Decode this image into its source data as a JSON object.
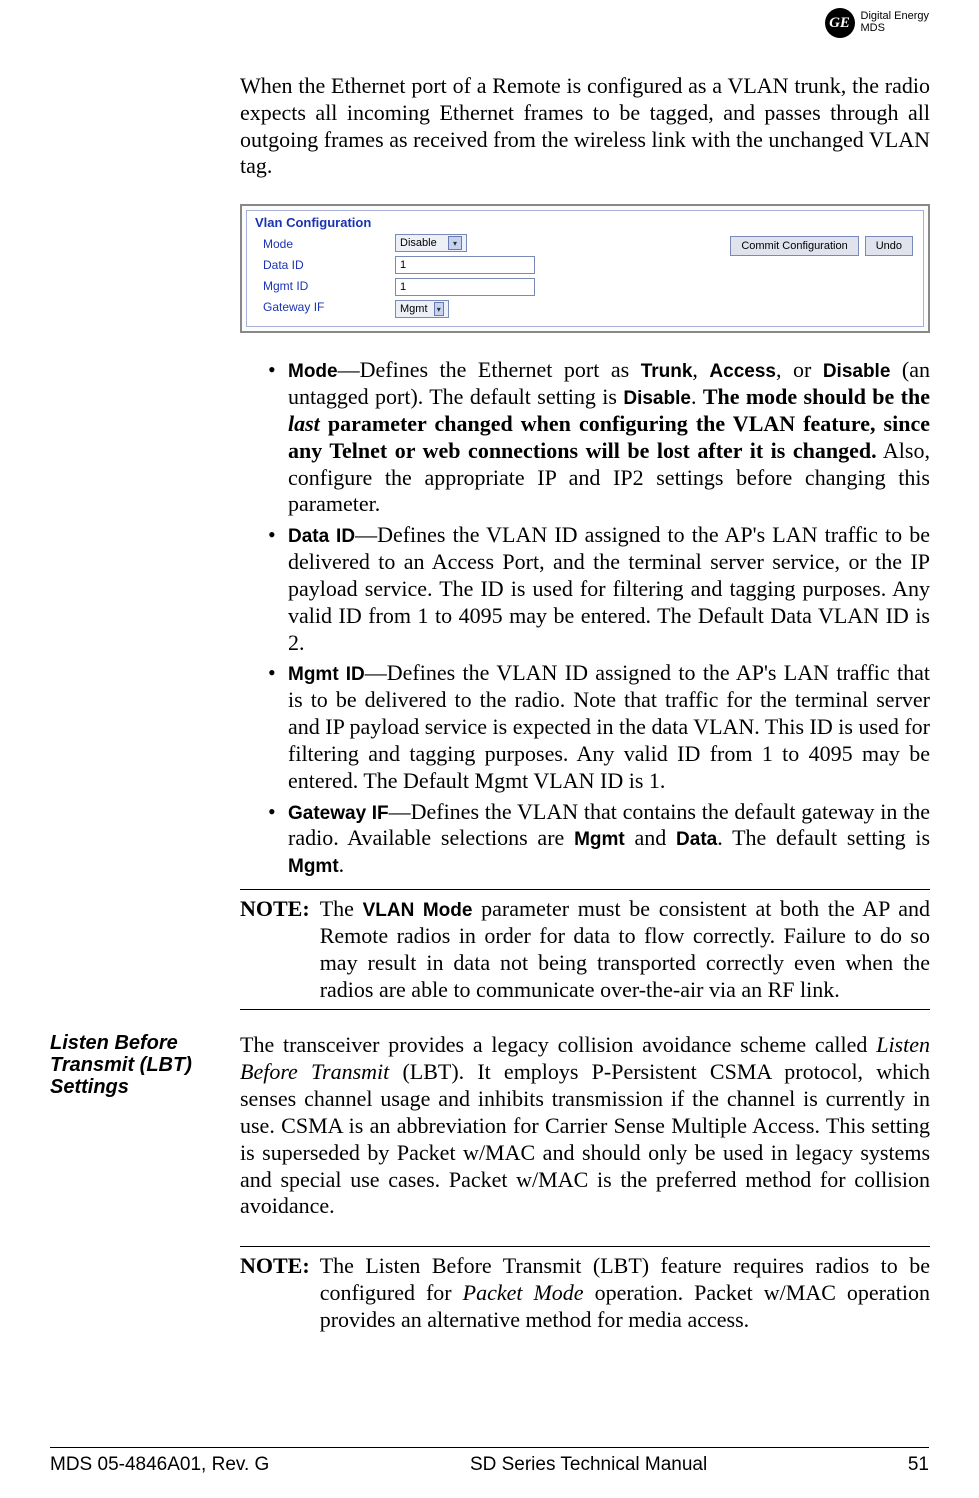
{
  "header": {
    "logo_monogram": "GE",
    "logo_line1": "Digital Energy",
    "logo_line2": "MDS"
  },
  "intro_paragraph": "When the Ethernet port of a Remote is configured as a VLAN trunk, the radio expects all incoming Ethernet frames to be tagged, and passes through all outgoing frames as received from the wireless link with the unchanged VLAN tag.",
  "panel": {
    "title": "Vlan Configuration",
    "labels": {
      "mode": "Mode",
      "data_id": "Data ID",
      "mgmt_id": "Mgmt ID",
      "gateway_if": "Gateway IF"
    },
    "values": {
      "mode": "Disable",
      "data_id": "1",
      "mgmt_id": "1",
      "gateway_if": "Mgmt"
    },
    "buttons": {
      "commit": "Commit Configuration",
      "undo": "Undo"
    }
  },
  "bullets": {
    "mode": {
      "label": "Mode",
      "t1": "—Defines the Ethernet port as ",
      "opt1": "Trunk",
      "comma": ", ",
      "opt2": "Access",
      "t2": ", or ",
      "opt3": "Disable",
      "t3": " (an untagged port). The default setting is ",
      "opt4": "Disable",
      "t4": ". ",
      "bold1": "The mode should be the ",
      "ital": "last",
      "bold2": " parameter changed when configuring the VLAN feature, since any Telnet or web connections will be lost after it is changed.",
      "t5": " Also, configure the appropriate IP and IP2 settings before changing this parameter."
    },
    "data_id": {
      "label": "Data ID",
      "text": "—Defines the VLAN ID assigned to the AP's LAN traffic to be delivered to an Access Port, and the terminal server service, or the IP payload service. The ID is used for filtering and tagging purposes. Any valid ID from 1 to 4095 may be entered. The Default Data VLAN ID is 2."
    },
    "mgmt_id": {
      "label": "Mgmt ID",
      "text": "—Defines the VLAN ID assigned to the AP's LAN traffic that is to be delivered to the radio. Note that traffic for the terminal server and IP payload service is expected in the data VLAN. This ID is used for filtering and tagging purposes. Any valid ID from 1 to 4095 may be entered. The Default Mgmt VLAN ID is 1."
    },
    "gateway_if": {
      "label": "Gateway IF",
      "t1": "—Defines the VLAN that contains the default gateway in the radio. Available selections are ",
      "opt1": "Mgmt",
      "t2": " and ",
      "opt2": "Data",
      "t3": ". The default setting is ",
      "opt3": "Mgmt",
      "t4": "."
    }
  },
  "note1": {
    "label": "NOTE:",
    "t1": "The ",
    "bold": "VLAN Mode",
    "t2": " parameter must be consistent at both the AP and Remote radios in order for data to flow correctly. Failure to do so may result in data not being transported correctly even when the radios are able to communicate over-the-air via an RF link."
  },
  "lbt": {
    "heading": "Listen Before Transmit (LBT) Settings",
    "p1a": "The transceiver provides a legacy collision avoidance scheme called ",
    "ital": "Listen Before Transmit",
    "p1b": " (LBT). It employs P-Persistent CSMA protocol, which senses channel usage and inhibits transmission if the channel is currently in use. CSMA is an abbreviation for Carrier Sense Multiple Access. This setting is superseded by Packet w/MAC and should only be used in legacy systems and special use cases. Packet w/MAC is the preferred method for collision avoidance."
  },
  "note2": {
    "label": "NOTE:",
    "t1": "The Listen Before Transmit (LBT) feature requires radios to be configured for ",
    "ital": "Packet Mode",
    "t2": " operation. Packet w/MAC operation provides an alternative method for media access."
  },
  "footer": {
    "left": "MDS 05-4846A01, Rev. G",
    "center": "SD Series Technical Manual",
    "right": "51"
  }
}
